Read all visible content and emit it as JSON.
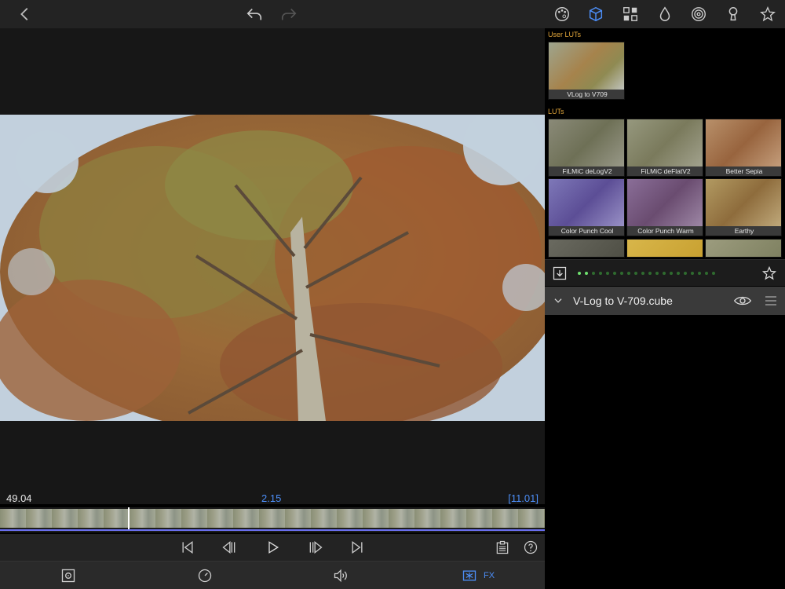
{
  "toolbar": {
    "icons": [
      "chevron-left-icon",
      "undo-icon",
      "redo-icon",
      "palette-icon",
      "lut-cube-icon",
      "grid-icon",
      "drop-icon",
      "spiral-icon",
      "keyhole-icon",
      "star-icon"
    ],
    "active_color": "#4c8ef7"
  },
  "viewer": {
    "time_left": "49.04",
    "time_current": "2.15",
    "time_right": "[11.01]"
  },
  "transport": {
    "icons": [
      "skip-start-icon",
      "step-back-icon",
      "play-icon",
      "step-forward-icon",
      "skip-end-icon",
      "clipboard-icon",
      "help-icon"
    ]
  },
  "bottom_tabs": {
    "fx_label": "FX",
    "icons": [
      "frame-icon",
      "speed-icon",
      "volume-icon",
      "fx-icon"
    ]
  },
  "panel": {
    "user_luts_label": "User LUTs",
    "luts_label": "LUTs",
    "user_luts": [
      {
        "label": "VLog to V709"
      }
    ],
    "luts": [
      {
        "label": "FiLMiC deLogV2"
      },
      {
        "label": "FiLMiC deFlatV2"
      },
      {
        "label": "Better Sepia"
      },
      {
        "label": "Color Punch Cool"
      },
      {
        "label": "Color Punch Warm"
      },
      {
        "label": "Earthy"
      }
    ],
    "page_dots_total": 20,
    "page_dots_active": 2,
    "file_name": "V-Log to V-709.cube"
  }
}
